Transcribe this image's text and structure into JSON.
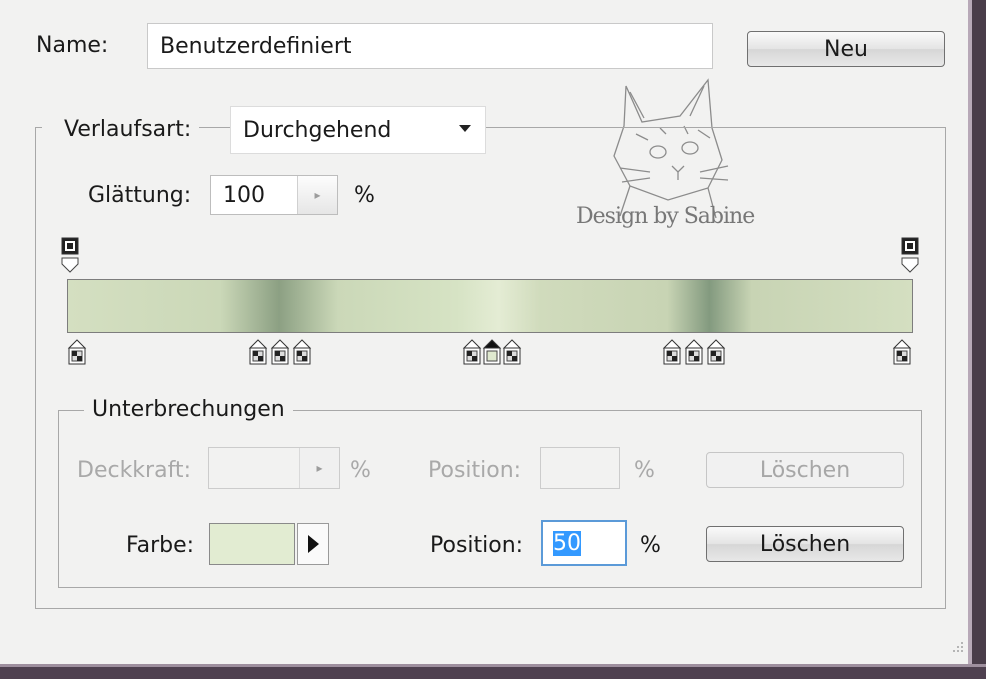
{
  "name_row": {
    "label": "Name:",
    "value": "Benutzerdefiniert",
    "new_button": "Neu"
  },
  "gradient": {
    "type_label": "Verlaufsart:",
    "type_value": "Durchgehend",
    "smoothness_label": "Glättung:",
    "smoothness_value": "100",
    "smoothness_unit": "%",
    "colors": [
      "#d4dfc1",
      "#cbd8b8",
      "#8ca083",
      "#e4ecd4",
      "#839a7f"
    ]
  },
  "stops_group": {
    "title": "Unterbrechungen",
    "opacity_label": "Deckkraft:",
    "opacity_unit": "%",
    "opacity_position_label": "Position:",
    "opacity_position_unit": "%",
    "opacity_delete": "Löschen",
    "color_label": "Farbe:",
    "color_swatch": "#e2ecd2",
    "color_position_label": "Position:",
    "color_position_value": "50",
    "color_position_unit": "%",
    "color_delete": "Löschen"
  },
  "watermark": {
    "text": "Design by Sabine"
  }
}
